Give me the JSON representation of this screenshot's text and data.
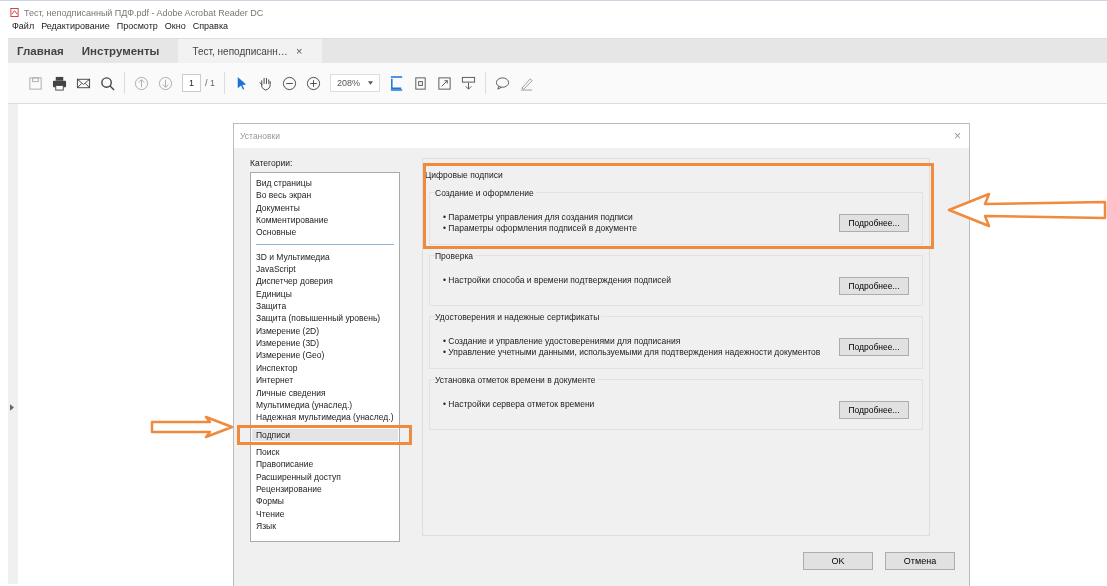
{
  "window": {
    "title": "Тест, неподписанный ПДФ.pdf - Adobe Acrobat Reader DC"
  },
  "menu": [
    "Файл",
    "Редактирование",
    "Просмотр",
    "Окно",
    "Справка"
  ],
  "tabs": [
    {
      "label": "Главная",
      "kind": "nav",
      "selected": false
    },
    {
      "label": "Инструменты",
      "kind": "nav",
      "selected": false
    },
    {
      "label": "Тест, неподписанн…",
      "kind": "document",
      "selected": true,
      "close": "×"
    }
  ],
  "toolbar": {
    "page_current": "1",
    "page_total": "/ 1",
    "zoom": "208%"
  },
  "dialog": {
    "title": "Установки",
    "close": "×",
    "categories_label": "Категории:",
    "categories_primary": [
      {
        "label": "Вид страницы",
        "selected": false
      },
      {
        "label": "Во весь экран",
        "selected": false
      },
      {
        "label": "Документы",
        "selected": false
      },
      {
        "label": "Комментирование",
        "selected": false
      },
      {
        "label": "Основные",
        "selected": false
      }
    ],
    "categories_other": [
      {
        "label": "3D и Мультимедиа",
        "selected": false
      },
      {
        "label": "JavaScript",
        "selected": false
      },
      {
        "label": "Диспетчер доверия",
        "selected": false
      },
      {
        "label": "Единицы",
        "selected": false
      },
      {
        "label": "Защита",
        "selected": false
      },
      {
        "label": "Защита (повышенный уровень)",
        "selected": false
      },
      {
        "label": "Измерение (2D)",
        "selected": false
      },
      {
        "label": "Измерение (3D)",
        "selected": false
      },
      {
        "label": "Измерение (Geo)",
        "selected": false
      },
      {
        "label": "Инспектор",
        "selected": false
      },
      {
        "label": "Интернет",
        "selected": false
      },
      {
        "label": "Личные сведения",
        "selected": false
      },
      {
        "label": "Мультимедиа (унаслед.)",
        "selected": false
      },
      {
        "label": "Надежная мультимедиа (унаслед.)",
        "selected": false
      },
      {
        "label": "Подписи",
        "selected": true
      },
      {
        "label": "Поиск",
        "selected": false
      },
      {
        "label": "Правописание",
        "selected": false
      },
      {
        "label": "Расширенный доступ",
        "selected": false
      },
      {
        "label": "Рецензирование",
        "selected": false
      },
      {
        "label": "Формы",
        "selected": false
      },
      {
        "label": "Чтение",
        "selected": false
      },
      {
        "label": "Язык",
        "selected": false
      }
    ],
    "panel_title": "Цифровые подписи",
    "sections": [
      {
        "legend": "Создание и оформление",
        "bullets": [
          "• Параметры управления для создания подписи",
          "• Параметры оформления подписей в документе"
        ],
        "button": "Подробнее..."
      },
      {
        "legend": "Проверка",
        "bullets": [
          "• Настройки способа и времени подтверждения подписей"
        ],
        "button": "Подробнее..."
      },
      {
        "legend": "Удостоверения и надежные сертификаты",
        "bullets": [
          "• Создание и управление удостоверениями для подписания",
          "• Управление учетными данными, используемыми для подтверждения надежности документов"
        ],
        "button": "Подробнее..."
      },
      {
        "legend": "Установка отметок времени в документе",
        "bullets": [
          "• Настройки сервера отметок времени"
        ],
        "button": "Подробнее..."
      }
    ],
    "buttons": [
      "OK",
      "Отмена"
    ]
  }
}
